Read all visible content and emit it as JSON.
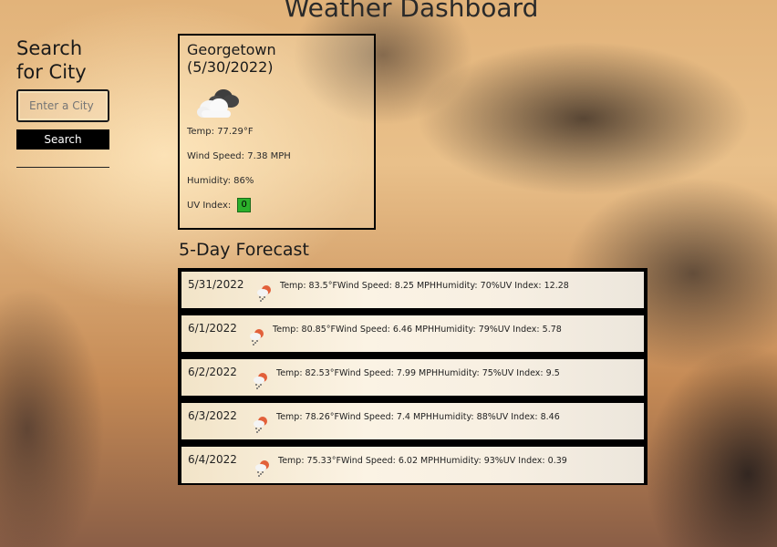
{
  "app": {
    "title": "Weather Dashboard"
  },
  "sidebar": {
    "heading": "Search for City",
    "input_placeholder": "Enter a City",
    "search_label": "Search"
  },
  "current": {
    "heading": "Georgetown (5/30/2022)",
    "icon": "broken-clouds-icon",
    "temp": "Temp: 77.29°F",
    "wind": "Wind Speed: 7.38 MPH",
    "humidity": "Humidity: 86%",
    "uv_label": "UV Index:",
    "uv_value": "0",
    "uv_color": "#2bb02b"
  },
  "forecast": {
    "heading": "5-Day Forecast",
    "icon": "rain-icon",
    "days": [
      {
        "date": "5/31/2022",
        "info": "Temp: 83.5°FWind Speed: 8.25 MPHHumidity: 70%UV Index: 12.28"
      },
      {
        "date": "6/1/2022",
        "info": "Temp: 80.85°FWind Speed: 6.46 MPHHumidity: 79%UV Index: 5.78"
      },
      {
        "date": "6/2/2022",
        "info": "Temp: 82.53°FWind Speed: 7.99 MPHHumidity: 75%UV Index: 9.5"
      },
      {
        "date": "6/3/2022",
        "info": "Temp: 78.26°FWind Speed: 7.4 MPHHumidity: 88%UV Index: 8.46"
      },
      {
        "date": "6/4/2022",
        "info": "Temp: 75.33°FWind Speed: 6.02 MPHHumidity: 93%UV Index: 0.39"
      }
    ]
  }
}
